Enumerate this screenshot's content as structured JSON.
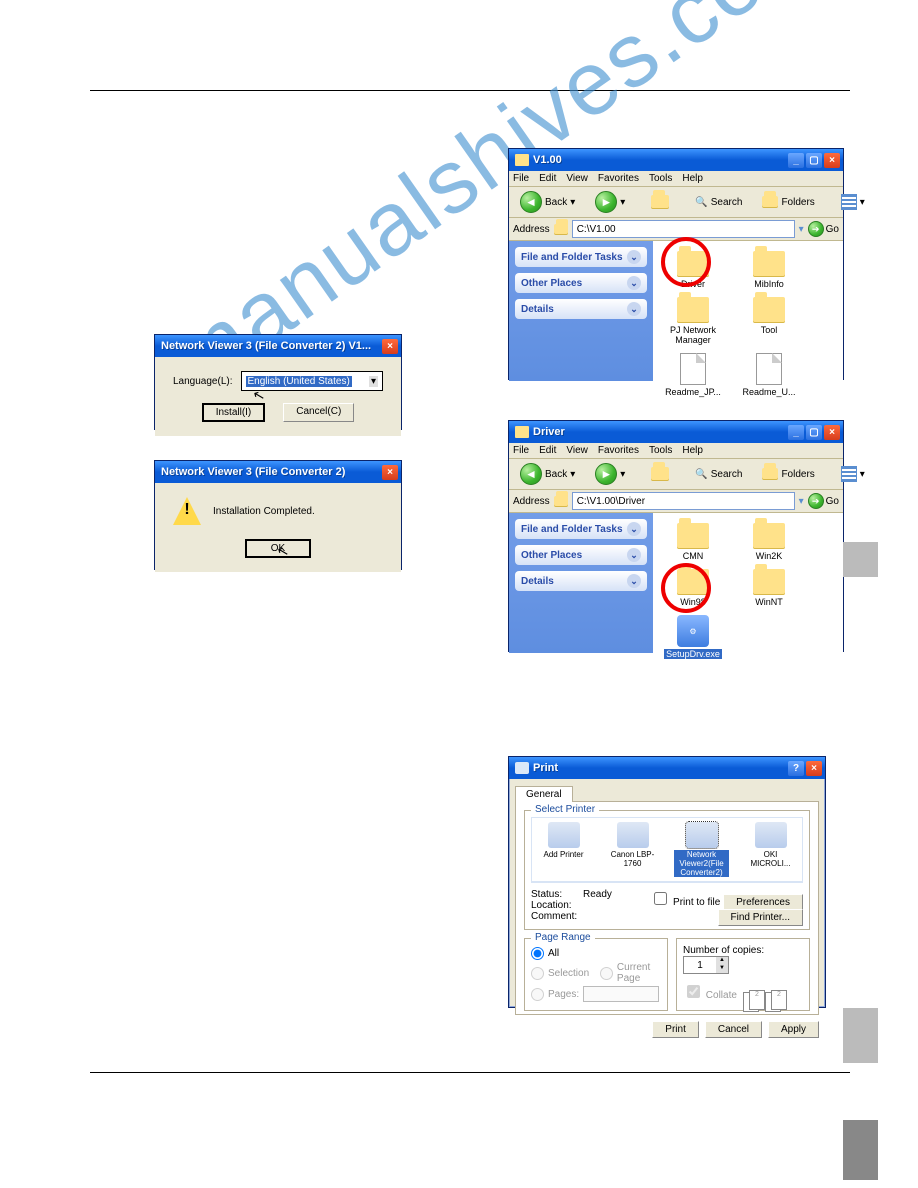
{
  "watermark": "manualshives.com",
  "explorer1": {
    "title": "V1.00",
    "menus": [
      "File",
      "Edit",
      "View",
      "Favorites",
      "Tools",
      "Help"
    ],
    "back": "Back",
    "search": "Search",
    "folders": "Folders",
    "addressLabel": "Address",
    "address": "C:\\V1.00",
    "go": "Go",
    "side1": "File and Folder Tasks",
    "side2": "Other Places",
    "side3": "Details",
    "items": [
      {
        "type": "folder",
        "label": "Driver"
      },
      {
        "type": "folder",
        "label": "MibInfo"
      },
      {
        "type": "folder",
        "label": "PJ Network Manager"
      },
      {
        "type": "folder",
        "label": "Tool"
      },
      {
        "type": "file",
        "label": "Readme_JP..."
      },
      {
        "type": "file",
        "label": "Readme_U..."
      }
    ]
  },
  "explorer2": {
    "title": "Driver",
    "menus": [
      "File",
      "Edit",
      "View",
      "Favorites",
      "Tools",
      "Help"
    ],
    "back": "Back",
    "search": "Search",
    "folders": "Folders",
    "addressLabel": "Address",
    "address": "C:\\V1.00\\Driver",
    "go": "Go",
    "side1": "File and Folder Tasks",
    "side2": "Other Places",
    "side3": "Details",
    "items": [
      {
        "type": "folder",
        "label": "CMN"
      },
      {
        "type": "folder",
        "label": "Win2K"
      },
      {
        "type": "folder",
        "label": "Win98"
      },
      {
        "type": "folder",
        "label": "WinNT"
      },
      {
        "type": "setup",
        "label": "SetupDrv.exe"
      }
    ]
  },
  "lang_dlg": {
    "title": "Network Viewer 3 (File Converter 2) V1...",
    "langLabel": "Language(L):",
    "langValue": "English (United States)",
    "install": "Install(I)",
    "cancel": "Cancel(C)"
  },
  "done_dlg": {
    "title": "Network Viewer 3 (File Converter 2)",
    "message": "Installation Completed.",
    "ok": "OK"
  },
  "print": {
    "title": "Print",
    "tab": "General",
    "selectPrinter": "Select Printer",
    "printers": [
      {
        "label": "Add Printer"
      },
      {
        "label": "Canon LBP-1760"
      },
      {
        "label": "Network Viewer2(File Converter2)",
        "selected": true
      },
      {
        "label": "OKI MICROLI..."
      }
    ],
    "statusLabel": "Status:",
    "statusValue": "Ready",
    "locationLabel": "Location:",
    "commentLabel": "Comment:",
    "printToFile": "Print to file",
    "preferences": "Preferences",
    "findPrinter": "Find Printer...",
    "pageRange": "Page Range",
    "all": "All",
    "selection": "Selection",
    "currentPage": "Current Page",
    "pages": "Pages:",
    "copiesLabel": "Number of copies:",
    "copiesValue": "1",
    "collate": "Collate",
    "printBtn": "Print",
    "cancelBtn": "Cancel",
    "applyBtn": "Apply"
  }
}
